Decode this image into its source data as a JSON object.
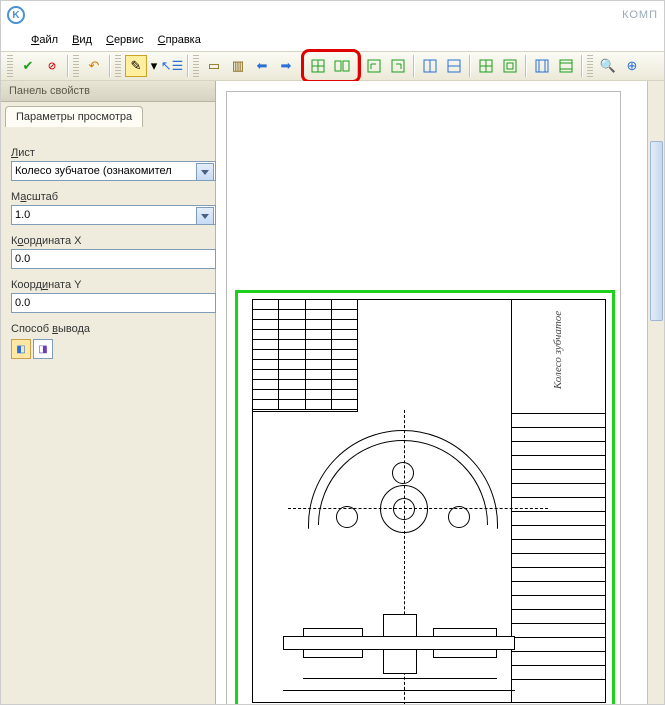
{
  "title_right": "КОМП",
  "menu": {
    "file": "Файл",
    "view": "Вид",
    "service": "Сервис",
    "help": "Справка"
  },
  "panel": {
    "header": "Панель свойств",
    "tab": "Параметры просмотра",
    "sheet_label": "Лист",
    "sheet_value": "Колесо зубчатое (ознакомител",
    "scale_label": "Масштаб",
    "scale_value": "1.0",
    "coordx_label": "Координата X",
    "coordx_value": "0.0",
    "coordy_label": "Координата Y",
    "coordy_value": "0.0",
    "output_label": "Способ вывода"
  },
  "drawing": {
    "part_name": "Колесо зубчатое"
  },
  "icons": {
    "app": "K",
    "ok": "✔",
    "stop": "✖",
    "page": "▭",
    "magnifier": "🔍",
    "fit": "⛶",
    "prev": "⬅",
    "next": "➡"
  }
}
